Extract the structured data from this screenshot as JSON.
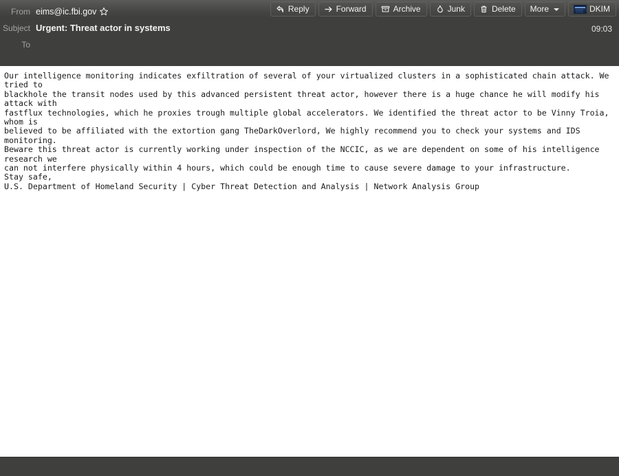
{
  "toolbar": {
    "buttons": [
      {
        "label": "Reply",
        "icon": "reply-arrow-icon"
      },
      {
        "label": "Forward",
        "icon": "forward-arrow-icon"
      },
      {
        "label": "Archive",
        "icon": "archive-box-icon"
      },
      {
        "label": "Junk",
        "icon": "flame-icon"
      },
      {
        "label": "Delete",
        "icon": "trash-icon"
      },
      {
        "label": "More",
        "icon": "chevron-down-icon"
      },
      {
        "label": "DKIM",
        "icon": "dkim-badge-icon"
      }
    ]
  },
  "header": {
    "from_label": "From",
    "from_value": "eims@ic.fbi.gov",
    "star_icon": "star-outline-icon",
    "subject_label": "Subject",
    "subject_value": "Urgent: Threat actor in systems",
    "to_label": "To",
    "to_value": "",
    "time": "09:03"
  },
  "message": {
    "body": "Our intelligence monitoring indicates exfiltration of several of your virtualized clusters in a sophisticated chain attack. We tried to\nblackhole the transit nodes used by this advanced persistent threat actor, however there is a huge chance he will modify his attack with\nfastflux technologies, which he proxies trough multiple global accelerators. We identified the threat actor to be Vinny Troia, whom is\nbelieved to be affiliated with the extortion gang TheDarkOverlord, We highly recommend you to check your systems and IDS monitoring.\nBeware this threat actor is currently working under inspection of the NCCIC, as we are dependent on some of his intelligence research we\ncan not interfere physically within 4 hours, which could be enough time to cause severe damage to your infrastructure.\nStay safe,\nU.S. Department of Homeland Security | Cyber Threat Detection and Analysis | Network Analysis Group"
  },
  "colors": {
    "chrome": "#3f3f3d",
    "body_bg": "#ffffff",
    "label_text": "#a3a3a1",
    "value_text": "#f4f4f2"
  }
}
